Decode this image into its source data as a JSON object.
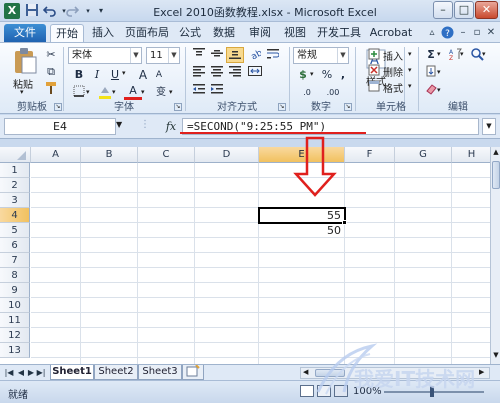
{
  "window": {
    "title": "Excel 2010函数教程.xlsx - Microsoft Excel",
    "app_icon": "X",
    "controls": {
      "minimize": "–",
      "maximize": "□",
      "close": "✕"
    }
  },
  "quick_access": {
    "save_icon": "save-icon",
    "undo_icon": "undo-icon",
    "redo_icon": "redo-icon",
    "customize_icon": "customize-qat-icon"
  },
  "ribbon_tabs": [
    {
      "label": "文件"
    },
    {
      "label": "开始"
    },
    {
      "label": "插入"
    },
    {
      "label": "页面布局"
    },
    {
      "label": "公式"
    },
    {
      "label": "数据"
    },
    {
      "label": "审阅"
    },
    {
      "label": "视图"
    },
    {
      "label": "开发工具"
    },
    {
      "label": "Acrobat"
    }
  ],
  "ribbon": {
    "clipboard": {
      "paste_label": "粘贴",
      "group_label": "剪贴板"
    },
    "font": {
      "font_name": "宋体",
      "font_size": "11",
      "bold": "B",
      "italic": "I",
      "underline": "U",
      "grow_font": "A",
      "shrink_font": "A",
      "font_color_glyph": "A",
      "style_glyph": "变",
      "group_label": "字体"
    },
    "alignment": {
      "group_label": "对齐方式"
    },
    "number": {
      "format_value": "常规",
      "group_label": "数字",
      "currency": "$",
      "percent": "%",
      "comma": ",",
      "inc_decimal": ".0",
      "dec_decimal": ".00"
    },
    "styles": {
      "label": "样式"
    },
    "cells": {
      "insert_label": "插入",
      "delete_label": "删除",
      "format_label": "格式",
      "group_label": "单元格"
    },
    "editing": {
      "group_label": "编辑",
      "sum_glyph": "Σ"
    }
  },
  "formula_bar": {
    "name_box": "E4",
    "fx_label": "fx",
    "formula": "=SECOND(\"9:25:55 PM\")"
  },
  "grid": {
    "columns": [
      "A",
      "B",
      "C",
      "D",
      "E",
      "F",
      "G",
      "H"
    ],
    "selected_column": "E",
    "rows": [
      "1",
      "2",
      "3",
      "4",
      "5",
      "6",
      "7",
      "8",
      "9",
      "10",
      "11",
      "12",
      "13"
    ],
    "selected_row": "4",
    "cells": {
      "E4": "55",
      "E5": "50"
    }
  },
  "sheets": [
    {
      "name": "Sheet1",
      "active": true
    },
    {
      "name": "Sheet2",
      "active": false
    },
    {
      "name": "Sheet3",
      "active": false
    }
  ],
  "status": {
    "ready": "就绪",
    "zoom": "100%"
  },
  "colors": {
    "accent": "#e0201d",
    "file_tab": "#1f62b1",
    "selected_header": "#f1c15f"
  }
}
